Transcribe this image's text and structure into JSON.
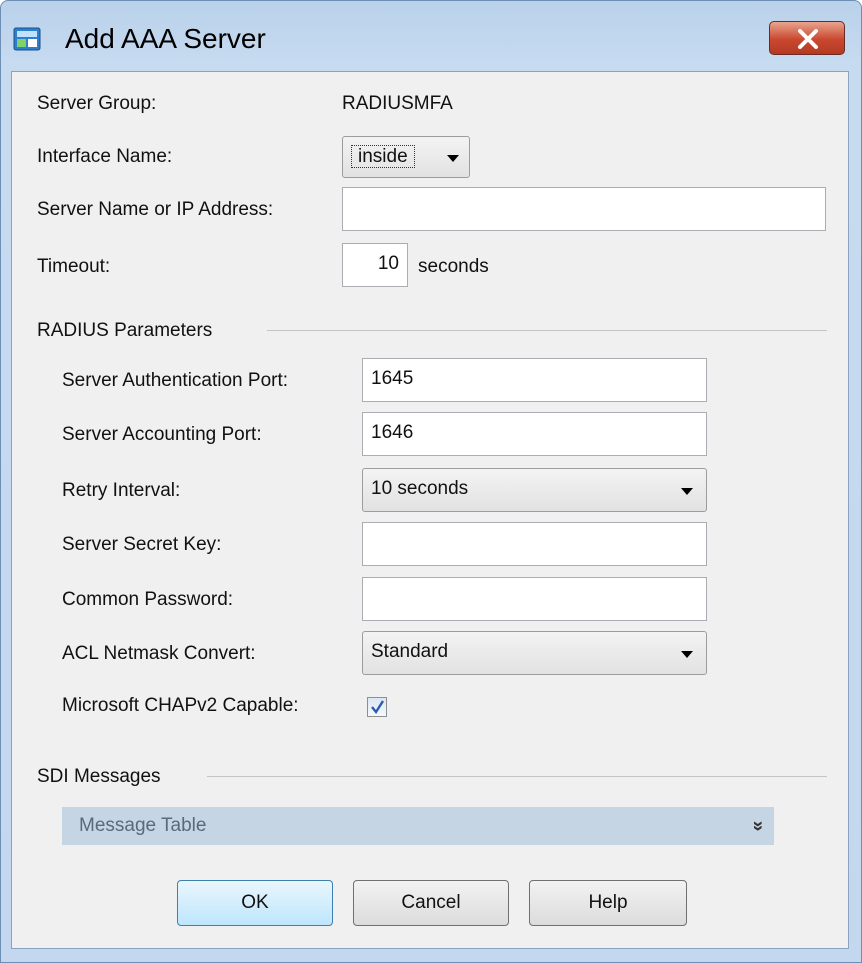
{
  "window": {
    "title": "Add AAA Server"
  },
  "fields": {
    "server_group_label": "Server Group:",
    "server_group_value": "RADIUSMFA",
    "interface_label": "Interface Name:",
    "interface_value": "inside",
    "server_name_label": "Server Name or IP Address:",
    "server_name_value": "",
    "timeout_label": "Timeout:",
    "timeout_value": "10",
    "timeout_unit": "seconds"
  },
  "radius": {
    "heading": "RADIUS Parameters",
    "auth_port_label": "Server Authentication Port:",
    "auth_port_value": "1645",
    "acct_port_label": "Server Accounting Port:",
    "acct_port_value": "1646",
    "retry_label": "Retry Interval:",
    "retry_value": "10 seconds",
    "secret_label": "Server Secret Key:",
    "secret_value": "",
    "common_pw_label": "Common Password:",
    "common_pw_value": "",
    "acl_label": "ACL Netmask Convert:",
    "acl_value": "Standard",
    "chap_label": "Microsoft CHAPv2 Capable:",
    "chap_checked": true
  },
  "sdi": {
    "heading": "SDI Messages",
    "message_table_label": "Message Table",
    "expand_glyph": "»"
  },
  "buttons": {
    "ok": "OK",
    "cancel": "Cancel",
    "help": "Help"
  },
  "colors": {
    "close_red": "#c9482f",
    "check_blue": "#2a5db0",
    "default_btn": "#bee6fd"
  }
}
